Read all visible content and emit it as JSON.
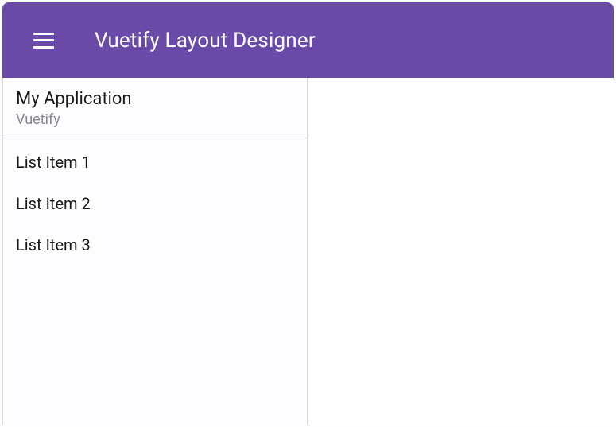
{
  "appBar": {
    "title": "Vuetify Layout Designer"
  },
  "navDrawer": {
    "header": {
      "title": "My Application",
      "subtitle": "Vuetify"
    },
    "items": [
      {
        "label": "List Item 1"
      },
      {
        "label": "List Item 2"
      },
      {
        "label": "List Item 3"
      }
    ]
  }
}
